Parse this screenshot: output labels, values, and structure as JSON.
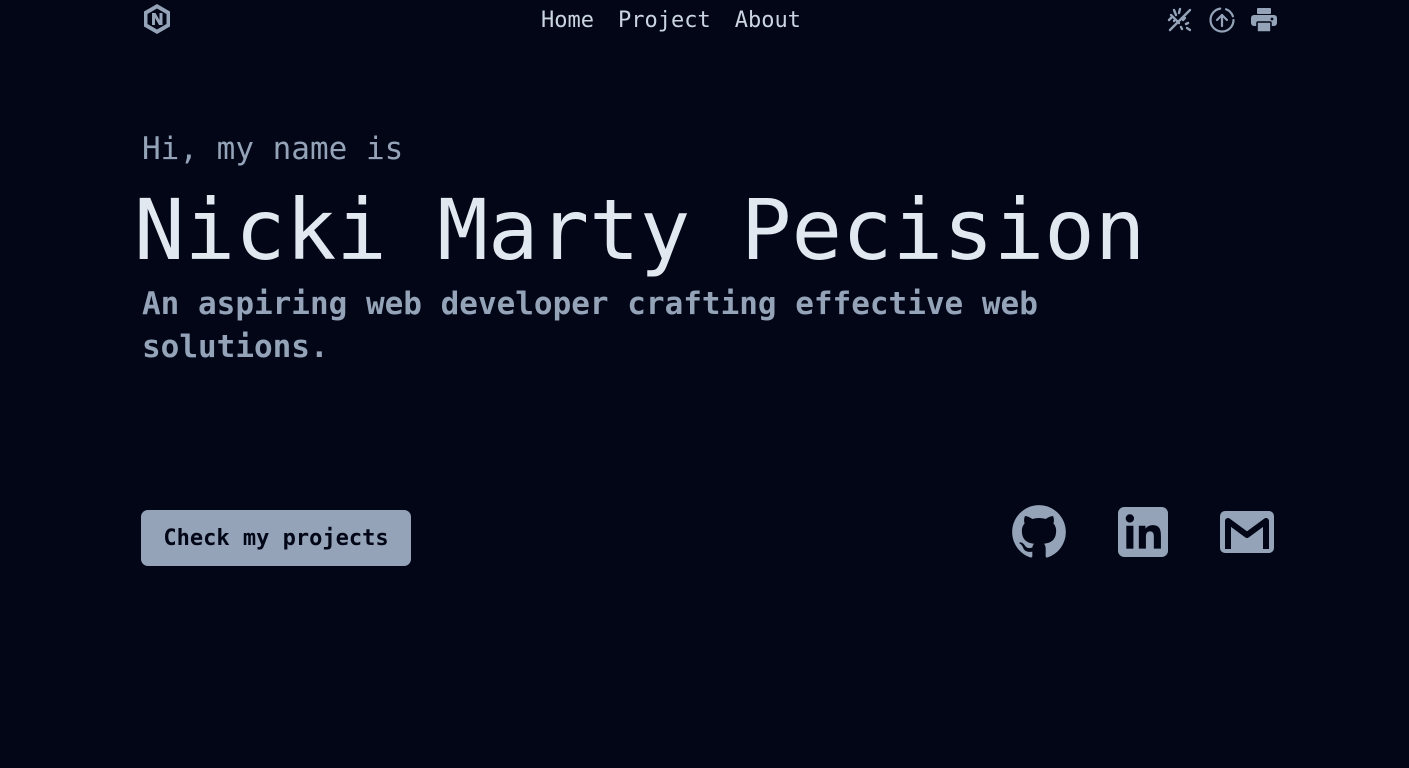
{
  "colors": {
    "background": "#020617",
    "text_primary": "#e2e8f0",
    "text_secondary": "#94a3b8",
    "icon": "#94a3b8",
    "button_bg": "#94a3b8",
    "button_text": "#020617"
  },
  "header": {
    "logo_icon": "hexagon-n-logo-icon",
    "nav": [
      {
        "label": "Home"
      },
      {
        "label": "Project"
      },
      {
        "label": "About"
      }
    ],
    "tools": [
      {
        "icon": "theme-toggle-icon"
      },
      {
        "icon": "scroll-top-icon"
      },
      {
        "icon": "printer-icon"
      }
    ]
  },
  "hero": {
    "greeting": "Hi, my name is",
    "name": "Nicki Marty Pecision",
    "tagline": "An aspiring web developer crafting effective web solutions.",
    "cta_label": "Check my projects"
  },
  "socials": [
    {
      "icon": "github-icon"
    },
    {
      "icon": "linkedin-icon"
    },
    {
      "icon": "gmail-icon"
    }
  ]
}
